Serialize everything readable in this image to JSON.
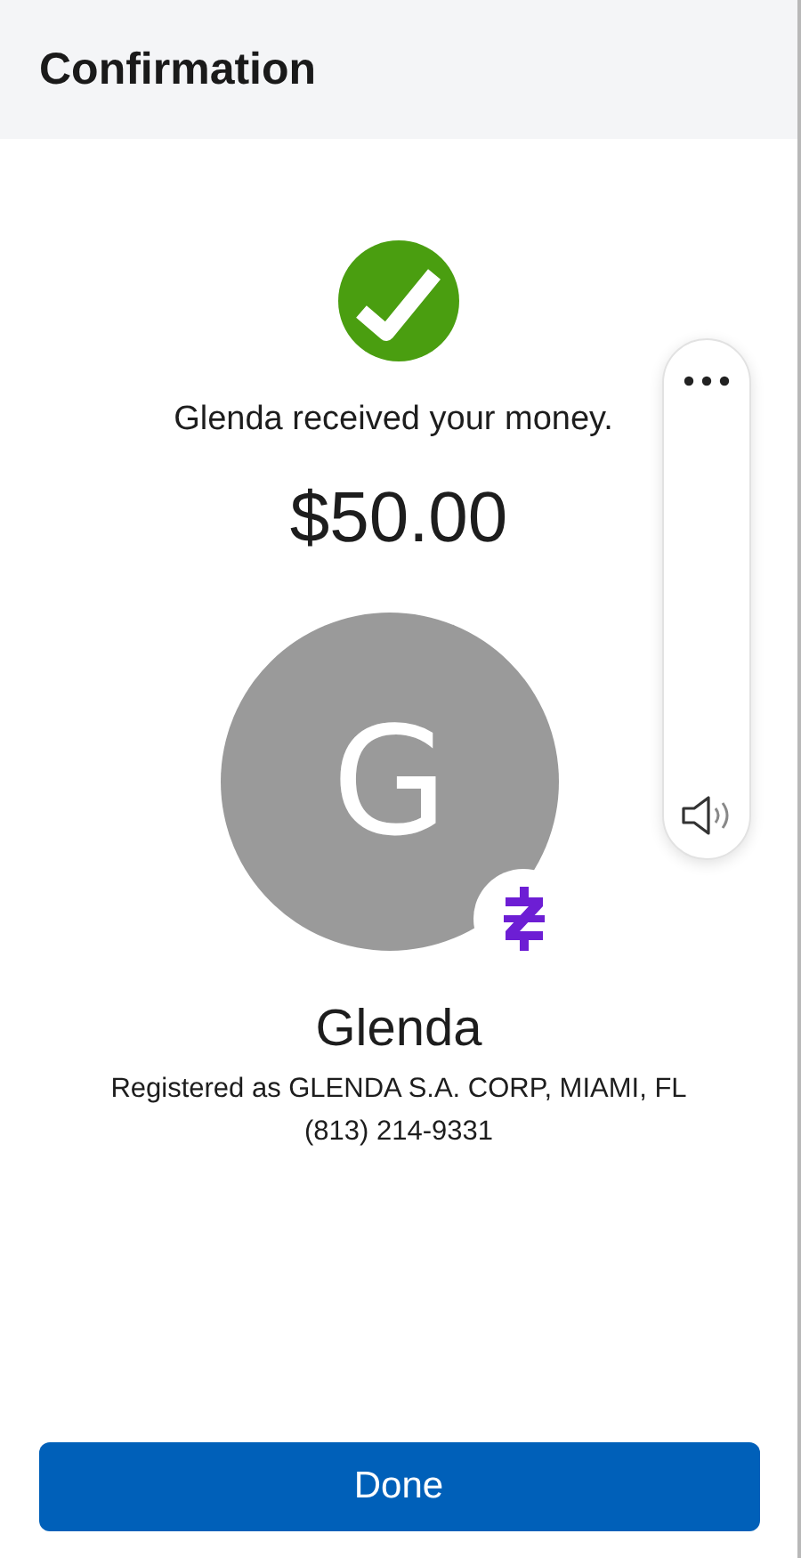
{
  "header": {
    "title": "Confirmation"
  },
  "status": {
    "kind": "success",
    "message": "Glenda received your money.",
    "amount": "$50.00"
  },
  "recipient": {
    "initial": "G",
    "name": "Glenda",
    "registered": "Registered as GLENDA S.A. CORP, MIAMI, FL",
    "phone": "(813) 214-9331"
  },
  "done_button": {
    "label": "Done"
  }
}
